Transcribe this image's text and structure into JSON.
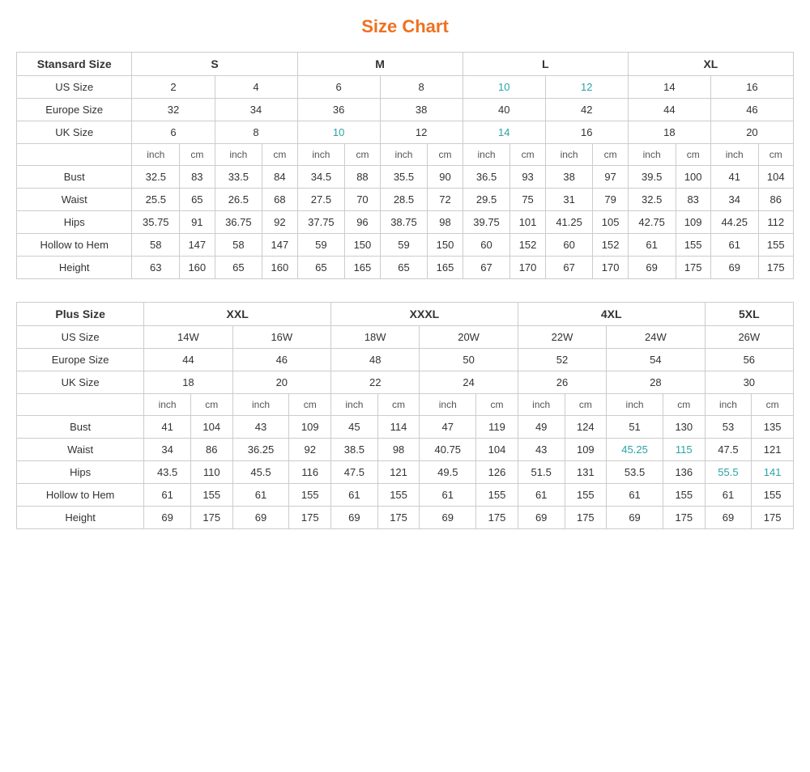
{
  "title": "Size Chart",
  "standard_table": {
    "headers": {
      "col1": "Stansard Size",
      "S": "S",
      "M": "M",
      "L": "L",
      "XL": "XL"
    },
    "us_size": {
      "label": "US Size",
      "values": [
        "2",
        "4",
        "6",
        "8",
        "10",
        "12",
        "14",
        "16"
      ]
    },
    "europe_size": {
      "label": "Europe Size",
      "values": [
        "32",
        "34",
        "36",
        "38",
        "40",
        "42",
        "44",
        "46"
      ]
    },
    "uk_size": {
      "label": "UK Size",
      "values": [
        "6",
        "8",
        "10",
        "12",
        "14",
        "16",
        "18",
        "20"
      ]
    },
    "units": [
      "inch",
      "cm",
      "inch",
      "cm",
      "inch",
      "cm",
      "inch",
      "cm",
      "inch",
      "cm",
      "inch",
      "cm",
      "inch",
      "cm",
      "inch",
      "cm"
    ],
    "bust": {
      "label": "Bust",
      "values": [
        "32.5",
        "83",
        "33.5",
        "84",
        "34.5",
        "88",
        "35.5",
        "90",
        "36.5",
        "93",
        "38",
        "97",
        "39.5",
        "100",
        "41",
        "104"
      ]
    },
    "waist": {
      "label": "Waist",
      "values": [
        "25.5",
        "65",
        "26.5",
        "68",
        "27.5",
        "70",
        "28.5",
        "72",
        "29.5",
        "75",
        "31",
        "79",
        "32.5",
        "83",
        "34",
        "86"
      ]
    },
    "hips": {
      "label": "Hips",
      "values": [
        "35.75",
        "91",
        "36.75",
        "92",
        "37.75",
        "96",
        "38.75",
        "98",
        "39.75",
        "101",
        "41.25",
        "105",
        "42.75",
        "109",
        "44.25",
        "112"
      ]
    },
    "hollow_to_hem": {
      "label": "Hollow to Hem",
      "values": [
        "58",
        "147",
        "58",
        "147",
        "59",
        "150",
        "59",
        "150",
        "60",
        "152",
        "60",
        "152",
        "61",
        "155",
        "61",
        "155"
      ]
    },
    "height": {
      "label": "Height",
      "values": [
        "63",
        "160",
        "65",
        "160",
        "65",
        "165",
        "65",
        "165",
        "67",
        "170",
        "67",
        "170",
        "69",
        "175",
        "69",
        "175"
      ]
    }
  },
  "plus_table": {
    "headers": {
      "col1": "Plus Size",
      "XXL": "XXL",
      "XXXL": "XXXL",
      "4XL": "4XL",
      "5XL": "5XL"
    },
    "us_size": {
      "label": "US Size",
      "values": [
        "14W",
        "16W",
        "18W",
        "20W",
        "22W",
        "24W",
        "26W"
      ]
    },
    "europe_size": {
      "label": "Europe Size",
      "values": [
        "44",
        "46",
        "48",
        "50",
        "52",
        "54",
        "56"
      ]
    },
    "uk_size": {
      "label": "UK Size",
      "values": [
        "18",
        "20",
        "22",
        "24",
        "26",
        "28",
        "30"
      ]
    },
    "units": [
      "inch",
      "cm",
      "inch",
      "cm",
      "inch",
      "cm",
      "inch",
      "cm",
      "inch",
      "cm",
      "inch",
      "cm",
      "inch",
      "cm"
    ],
    "bust": {
      "label": "Bust",
      "values": [
        "41",
        "104",
        "43",
        "109",
        "45",
        "114",
        "47",
        "119",
        "49",
        "124",
        "51",
        "130",
        "53",
        "135"
      ]
    },
    "waist": {
      "label": "Waist",
      "values": [
        "34",
        "86",
        "36.25",
        "92",
        "38.5",
        "98",
        "40.75",
        "104",
        "43",
        "109",
        "45.25",
        "115",
        "47.5",
        "121"
      ]
    },
    "hips": {
      "label": "Hips",
      "values": [
        "43.5",
        "110",
        "45.5",
        "116",
        "47.5",
        "121",
        "49.5",
        "126",
        "51.5",
        "131",
        "53.5",
        "136",
        "55.5",
        "141"
      ]
    },
    "hollow_to_hem": {
      "label": "Hollow to Hem",
      "values": [
        "61",
        "155",
        "61",
        "155",
        "61",
        "155",
        "61",
        "155",
        "61",
        "155",
        "61",
        "155",
        "61",
        "155"
      ]
    },
    "height": {
      "label": "Height",
      "values": [
        "69",
        "175",
        "69",
        "175",
        "69",
        "175",
        "69",
        "175",
        "69",
        "175",
        "69",
        "175",
        "69",
        "175"
      ]
    }
  }
}
